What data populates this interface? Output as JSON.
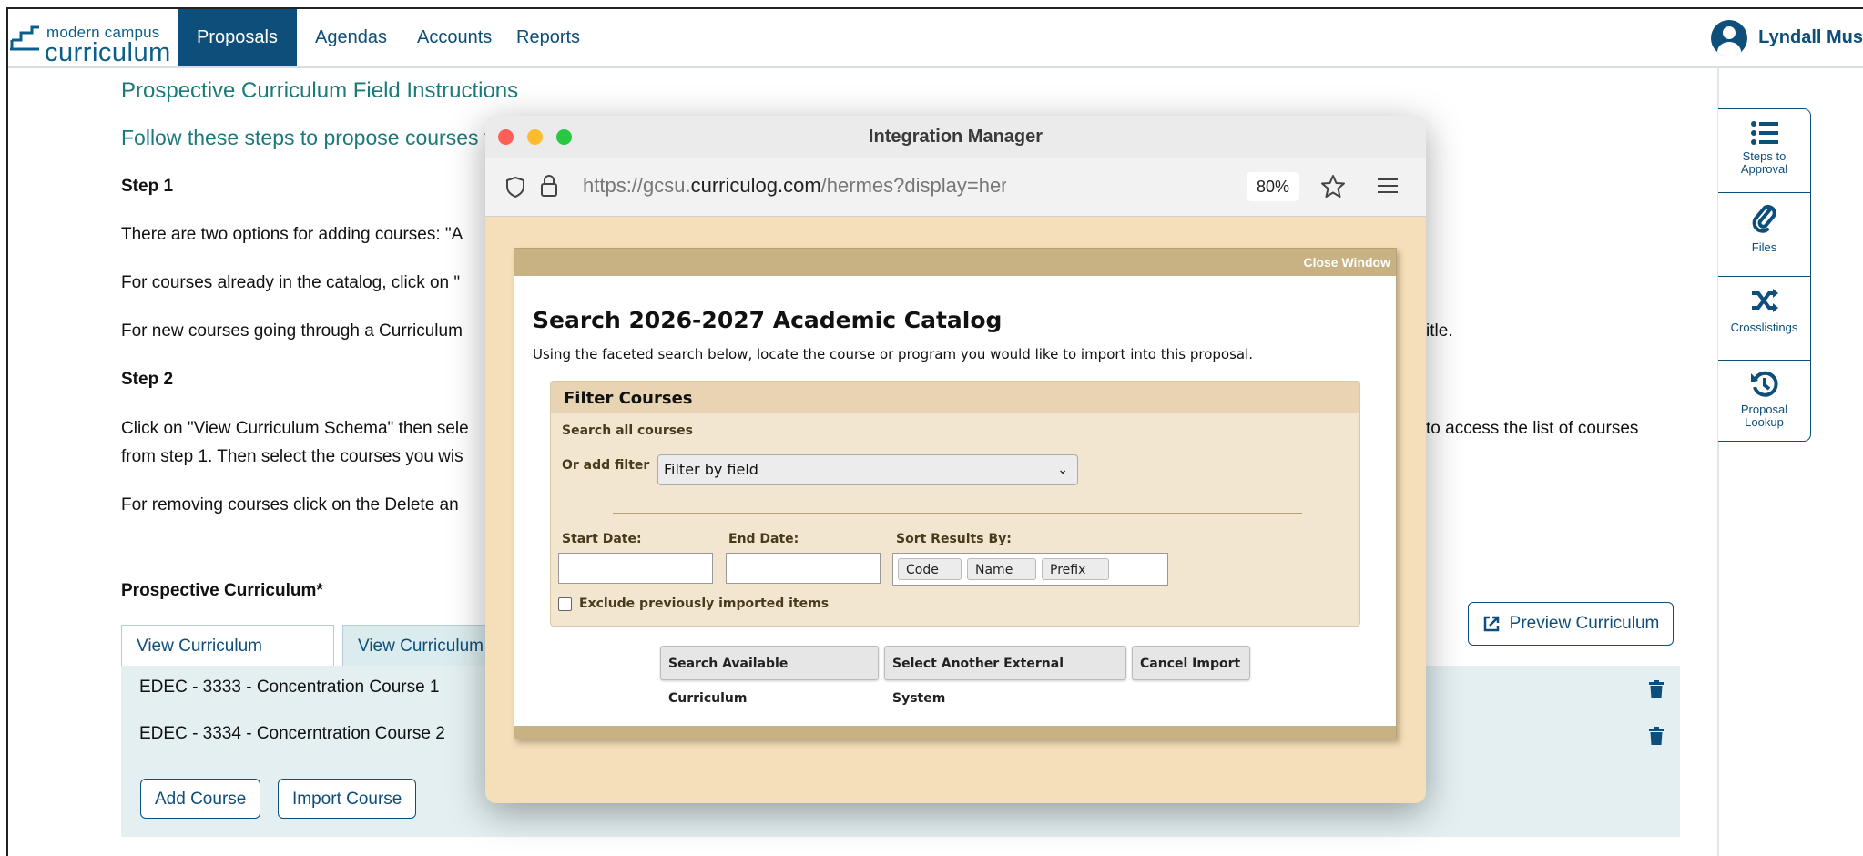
{
  "brand": {
    "small": "modern campus",
    "big": "curriculum"
  },
  "nav": {
    "items": [
      "Proposals",
      "Agendas",
      "Accounts",
      "Reports"
    ],
    "active": "Proposals"
  },
  "user": {
    "name": "Lyndall Mus"
  },
  "main": {
    "title": "Prospective Curriculum Field Instructions",
    "subtitle": "Follow these steps to propose courses to",
    "step1_heading": "Step 1",
    "step1_p1": "There are two options for adding courses: \"A",
    "step1_p2": "For courses already in the catalog, click on \"",
    "step1_p3": "For new courses going through a Curriculum",
    "step1_p3_tail": "itle.",
    "step2_heading": "Step 2",
    "step2_p1": "Click on \"View Curriculum Schema\" then sele",
    "step2_p1_tail": "to access the list of courses",
    "step2_p2": "from step 1. Then select the courses you wis",
    "step2_p3": "For removing courses click on the Delete an",
    "section_label": "Prospective Curriculum*"
  },
  "tabs": [
    "View Curriculum Courses",
    "View Curriculum S"
  ],
  "preview_button": "Preview Curriculum",
  "courses": [
    "EDEC - 3333 - Concentration Course 1",
    "EDEC - 3334 - Concerntration Course 2"
  ],
  "course_buttons": {
    "add": "Add Course",
    "import": "Import Course"
  },
  "side_panel": [
    {
      "label": "Steps to Approval",
      "icon": "list-icon"
    },
    {
      "label": "Files",
      "icon": "paperclip-icon"
    },
    {
      "label": "Crosslistings",
      "icon": "shuffle-icon"
    },
    {
      "label": "Proposal Lookup",
      "icon": "history-icon"
    }
  ],
  "popup": {
    "window_title": "Integration Manager",
    "url_prefix": "https://gcsu.",
    "url_domain": "curriculog.com",
    "url_path": "/hermes?display=hermesSearch&method:",
    "zoom": "80%",
    "close_window": "Close Window",
    "modal_title": "Search 2026-2027 Academic Catalog",
    "modal_desc": "Using the faceted search below, locate the course or program you would like to import into this proposal.",
    "filter": {
      "heading": "Filter Courses",
      "search_all": "Search all courses",
      "or_add_filter": "Or add filter",
      "select_value": "Filter by field",
      "start_date": "Start Date:",
      "end_date": "End Date:",
      "sort_by": "Sort Results By:",
      "sort_options": [
        "Code",
        "Name",
        "Prefix"
      ],
      "exclude_label": "Exclude previously imported items"
    },
    "buttons": {
      "search": "Search Available Curriculum",
      "select_external": "Select Another External System",
      "cancel": "Cancel Import"
    }
  },
  "colors": {
    "brand": "#0d4e7a",
    "teal_heading": "#1a7a7a",
    "popup_bg": "#f5dfb8",
    "modal_band": "#c8b284"
  }
}
